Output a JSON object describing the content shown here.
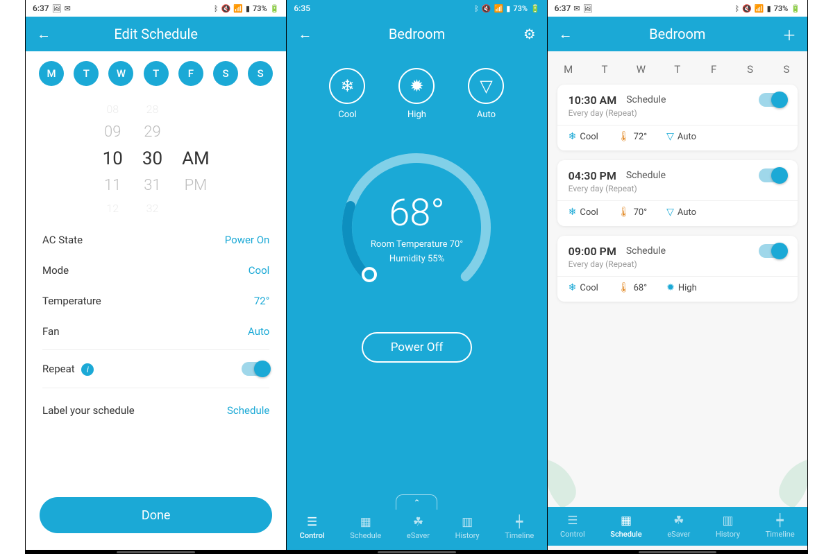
{
  "status_bar": {
    "battery": "73%",
    "s1_time": "6:37",
    "s2_time": "6:35",
    "s3_time": "6:37"
  },
  "screen1": {
    "title": "Edit Schedule",
    "days": [
      "M",
      "T",
      "W",
      "T",
      "F",
      "S",
      "S"
    ],
    "wheel": {
      "h_minus2": "08",
      "h_minus1": "09",
      "h_sel": "10",
      "h_plus1": "11",
      "h_plus2": "12",
      "m_minus2": "28",
      "m_minus1": "29",
      "m_sel": "30",
      "m_plus1": "31",
      "m_plus2": "32",
      "ap_sel": "AM",
      "ap_plus1": "PM"
    },
    "rows": {
      "ac_state_label": "AC State",
      "ac_state_value": "Power On",
      "mode_label": "Mode",
      "mode_value": "Cool",
      "temp_label": "Temperature",
      "temp_value": "72°",
      "fan_label": "Fan",
      "fan_value": "Auto",
      "repeat_label": "Repeat",
      "schedule_label": "Label your schedule",
      "schedule_value": "Schedule"
    },
    "done": "Done"
  },
  "screen2": {
    "title": "Bedroom",
    "modes": {
      "cool": "Cool",
      "high": "High",
      "auto": "Auto"
    },
    "target_temp": "68°",
    "room_temp": "Room Temperature 70°",
    "humidity": "Humidity 55%",
    "power": "Power Off",
    "nav": {
      "control": "Control",
      "schedule": "Schedule",
      "esaver": "eSaver",
      "history": "History",
      "timeline": "Timeline"
    }
  },
  "screen3": {
    "title": "Bedroom",
    "days": [
      "M",
      "T",
      "W",
      "T",
      "F",
      "S",
      "S"
    ],
    "cards": [
      {
        "time": "10:30 AM",
        "label": "Schedule",
        "sub": "Every day (Repeat)",
        "mode": "Cool",
        "temp": "72°",
        "fan": "Auto",
        "fan_icon": "auto"
      },
      {
        "time": "04:30 PM",
        "label": "Schedule",
        "sub": "Every day (Repeat)",
        "mode": "Cool",
        "temp": "70°",
        "fan": "Auto",
        "fan_icon": "auto"
      },
      {
        "time": "09:00 PM",
        "label": "Schedule",
        "sub": "Every day (Repeat)",
        "mode": "Cool",
        "temp": "68°",
        "fan": "High",
        "fan_icon": "high"
      }
    ],
    "nav": {
      "control": "Control",
      "schedule": "Schedule",
      "esaver": "eSaver",
      "history": "History",
      "timeline": "Timeline"
    }
  }
}
